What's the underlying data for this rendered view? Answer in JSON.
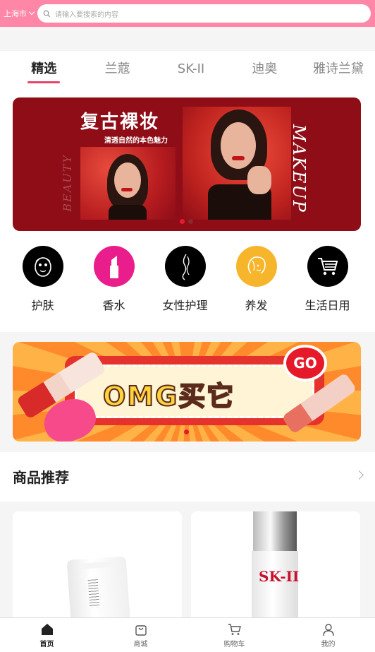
{
  "topbar": {
    "city": "上海市",
    "search_placeholder": "请输入要搜索的内容"
  },
  "tabs": [
    {
      "label": "精选",
      "active": true
    },
    {
      "label": "兰蔻",
      "active": false
    },
    {
      "label": "SK-II",
      "active": false
    },
    {
      "label": "迪奥",
      "active": false
    },
    {
      "label": "雅诗兰黛",
      "active": false
    }
  ],
  "banner": {
    "title": "复古裸妆",
    "subtitle": "清透自然的本色魅力",
    "side_text_left": "BEAUTY",
    "side_text_right": "MAKEUP",
    "bg_color": "#8e0d17"
  },
  "categories": [
    {
      "label": "护肤",
      "icon": "face-mask-icon",
      "bg": "#000000"
    },
    {
      "label": "香水",
      "icon": "lipstick-icon",
      "bg": "#e91e8c"
    },
    {
      "label": "女性护理",
      "icon": "female-body-icon",
      "bg": "#000000"
    },
    {
      "label": "养发",
      "icon": "hair-icon",
      "bg": "#f7b52c"
    },
    {
      "label": "生活日用",
      "icon": "shopping-cart-icon",
      "bg": "#000000"
    }
  ],
  "promo": {
    "text": "OMG买它",
    "go": "GO"
  },
  "recommend": {
    "title": "商品推荐"
  },
  "products": [
    {
      "brand_text": ""
    },
    {
      "brand_text": "SK-II"
    }
  ],
  "bottom_nav": [
    {
      "label": "首页",
      "icon": "home-icon",
      "active": true
    },
    {
      "label": "商城",
      "icon": "shopping-bag-icon",
      "active": false
    },
    {
      "label": "购物车",
      "icon": "cart-icon",
      "active": false
    },
    {
      "label": "我的",
      "icon": "user-icon",
      "active": false
    }
  ],
  "colors": {
    "accent": "#fe86a6",
    "tab_underline": "#e8436a"
  }
}
